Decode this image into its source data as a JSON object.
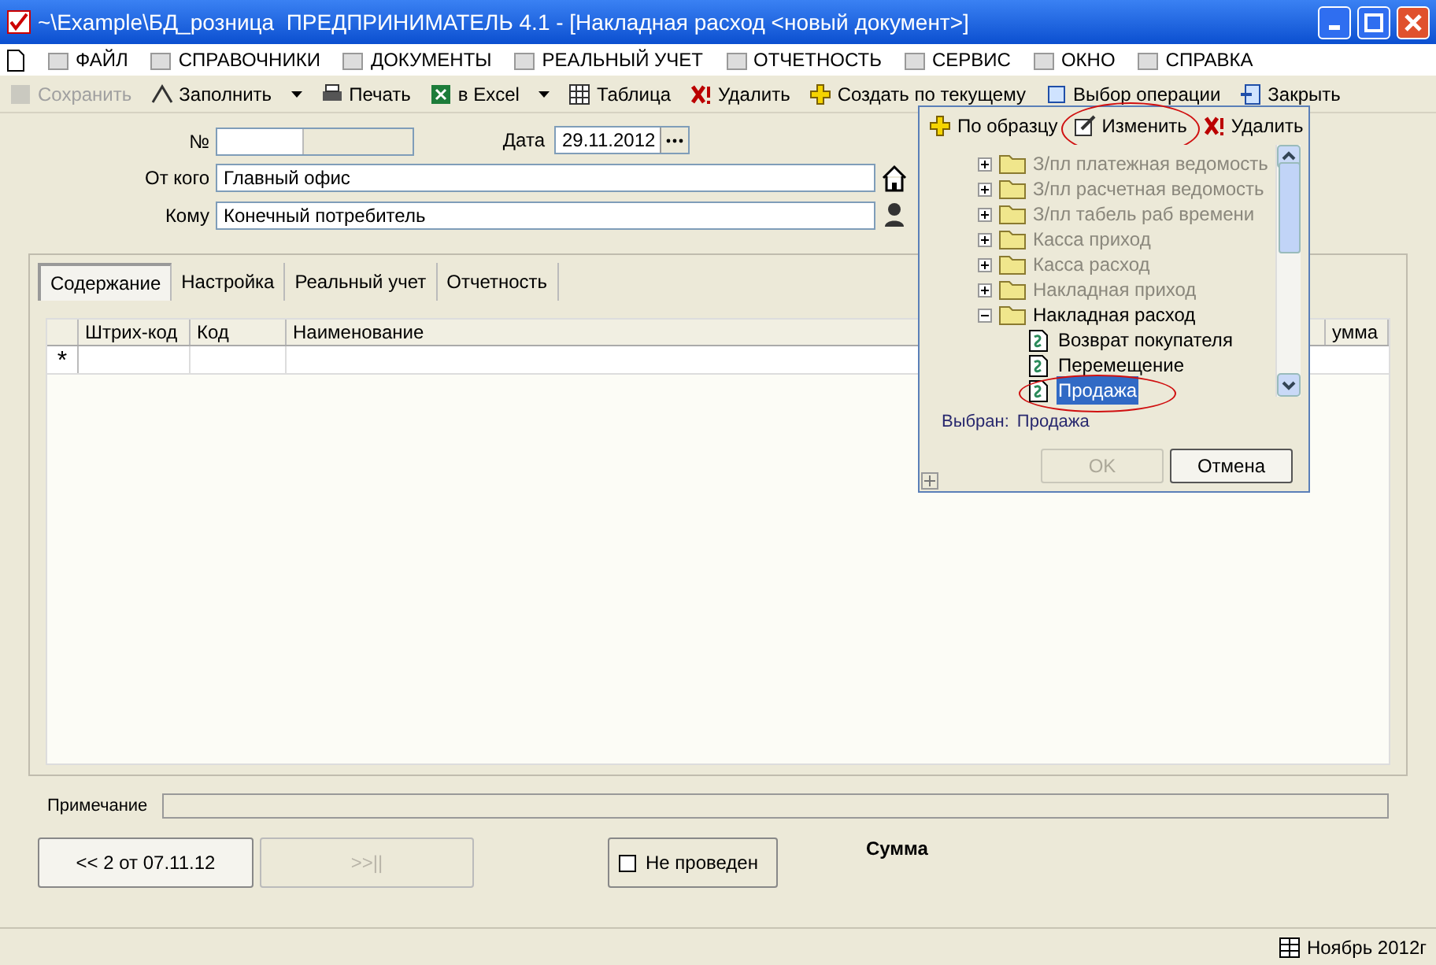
{
  "window": {
    "title": "~\\Example\\БД_розница  ПРЕДПРИНИМАТЕЛЬ 4.1 - [Накладная расход <новый документ>]"
  },
  "menu": [
    {
      "label": "ФАЙЛ"
    },
    {
      "label": "СПРАВОЧНИКИ"
    },
    {
      "label": "ДОКУМЕНТЫ"
    },
    {
      "label": "РЕАЛЬНЫЙ УЧЕТ"
    },
    {
      "label": "ОТЧЕТНОСТЬ"
    },
    {
      "label": "СЕРВИС"
    },
    {
      "label": "ОКНО"
    },
    {
      "label": "СПРАВКА"
    }
  ],
  "toolbar": [
    {
      "label": "Сохранить",
      "disabled": true,
      "kind": "save"
    },
    {
      "label": "Заполнить",
      "disabled": false,
      "kind": "fill",
      "dropdown": true
    },
    {
      "label": "Печать",
      "disabled": false,
      "kind": "print"
    },
    {
      "label": "в Excel",
      "disabled": false,
      "kind": "excel",
      "dropdown": true
    },
    {
      "label": "Таблица",
      "disabled": false,
      "kind": "table"
    },
    {
      "label": "Удалить",
      "disabled": false,
      "kind": "delete"
    },
    {
      "label": "Создать по текущему",
      "disabled": false,
      "kind": "create"
    },
    {
      "label": "Выбор операции",
      "disabled": false,
      "kind": "operation"
    },
    {
      "label": "Закрыть",
      "disabled": false,
      "kind": "close"
    }
  ],
  "form": {
    "number_label": "№",
    "date_label": "Дата",
    "date": "29.11.2012",
    "from_label": "От кого",
    "from": "Главный офис",
    "to_label": "Кому",
    "to": "Конечный потребитель"
  },
  "tabs": [
    {
      "label": "Содержание",
      "selected": true
    },
    {
      "label": "Настройка",
      "selected": false
    },
    {
      "label": "Реальный учет",
      "selected": false
    },
    {
      "label": "Отчетность",
      "selected": false
    }
  ],
  "table": {
    "columns": [
      "Штрих-код",
      "Код",
      "Наименование",
      "умма"
    ],
    "new_row_marker": "*"
  },
  "note_label": "Примечание",
  "nav": {
    "prev": "<< 2 от 07.11.12",
    "next": ">>||",
    "next_disabled": true
  },
  "posted": {
    "label": "Не проведен",
    "checked": false
  },
  "sum_label": "Сумма",
  "status_bar": {
    "period": "Ноябрь 2012г"
  },
  "popup": {
    "toolbar": [
      {
        "label": "По образцу",
        "kind": "add",
        "highlighted": false
      },
      {
        "label": "Изменить",
        "kind": "edit",
        "highlighted": true
      },
      {
        "label": "Удалить",
        "kind": "delete",
        "highlighted": false
      }
    ],
    "tree": [
      {
        "label": "З/пл платежная ведомость",
        "disabled": true,
        "expanded": false
      },
      {
        "label": "З/пл расчетная ведомость",
        "disabled": true,
        "expanded": false
      },
      {
        "label": "З/пл табель раб времени",
        "disabled": true,
        "expanded": false
      },
      {
        "label": "Касса приход",
        "disabled": true,
        "expanded": false
      },
      {
        "label": "Касса расход",
        "disabled": true,
        "expanded": false
      },
      {
        "label": "Накладная приход",
        "disabled": true,
        "expanded": false
      },
      {
        "label": "Накладная расход",
        "disabled": false,
        "expanded": true,
        "children": [
          {
            "label": "Возврат покупателя",
            "selected": false,
            "highlighted": false
          },
          {
            "label": "Перемещение",
            "selected": false,
            "highlighted": false
          },
          {
            "label": "Продажа",
            "selected": true,
            "highlighted": true
          }
        ]
      }
    ],
    "chosen_label": "Выбран:",
    "chosen": "Продажа",
    "ok": "OK",
    "ok_disabled": true,
    "cancel": "Отмена"
  }
}
